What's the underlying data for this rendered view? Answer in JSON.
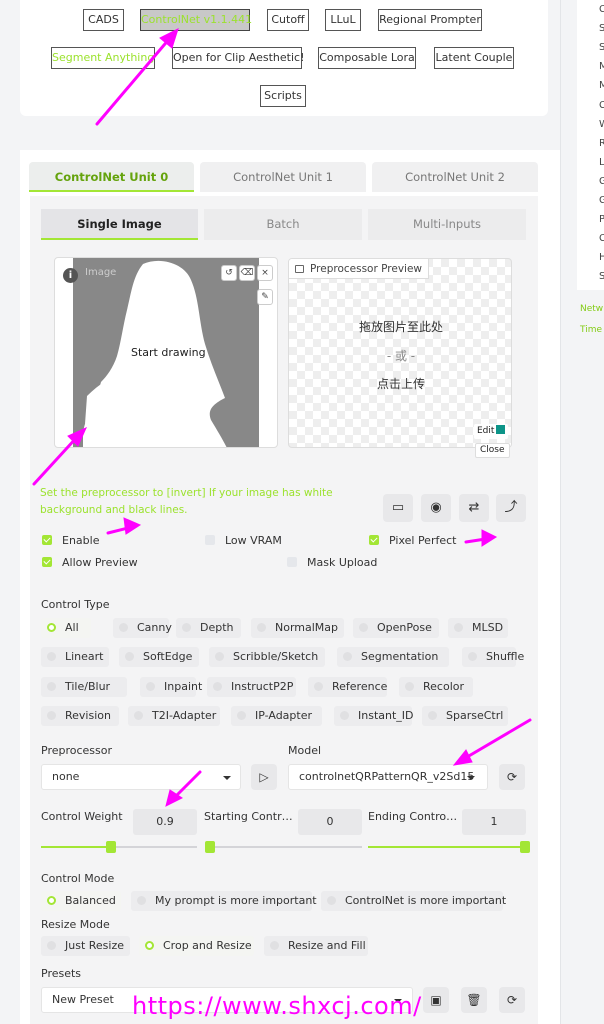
{
  "extensions": {
    "row1": [
      "CADS",
      "ControlNet v1.1.441",
      "Cutoff",
      "LLuL",
      "Regional Prompter"
    ],
    "row2": [
      "Segment Anything",
      "Open for Clip Aesthetic!",
      "Composable Lora",
      "Latent Couple"
    ],
    "row3": [
      "Scripts"
    ]
  },
  "right_sidebar": {
    "letters": [
      "C",
      "S",
      "S",
      "M",
      "M",
      "C",
      "W",
      "R",
      "L",
      "G",
      "G",
      "P",
      "C",
      "H",
      "S"
    ],
    "link1": "Netw",
    "link2": "Time"
  },
  "unit_tabs": [
    "ControlNet Unit 0",
    "ControlNet Unit 1",
    "ControlNet Unit 2"
  ],
  "image_tabs": [
    "Single Image",
    "Batch",
    "Multi-Inputs"
  ],
  "canvas": {
    "label": "Image",
    "start_drawing": "Start drawing",
    "info": "i"
  },
  "preview": {
    "title": "Preprocessor Preview",
    "drop_here": "拖放图片至此处",
    "or": "- 或 -",
    "click_upload": "点击上传",
    "edit": "Edit",
    "close": "Close"
  },
  "hint": "Set the preprocessor to [invert] If your image has white background and black lines.",
  "options": {
    "enable": "Enable",
    "low_vram": "Low VRAM",
    "pixel_perfect": "Pixel Perfect",
    "allow_preview": "Allow Preview",
    "mask_upload": "Mask Upload"
  },
  "control_type": {
    "label": "Control Type",
    "selected": "All",
    "row1": [
      "All",
      "Canny",
      "Depth",
      "NormalMap",
      "OpenPose",
      "MLSD"
    ],
    "row2": [
      "Lineart",
      "SoftEdge",
      "Scribble/Sketch",
      "Segmentation",
      "Shuffle"
    ],
    "row3": [
      "Tile/Blur",
      "Inpaint",
      "InstructP2P",
      "Reference",
      "Recolor"
    ],
    "row4": [
      "Revision",
      "T2I-Adapter",
      "IP-Adapter",
      "Instant_ID",
      "SparseCtrl"
    ]
  },
  "preprocessor": {
    "label": "Preprocessor",
    "value": "none"
  },
  "model": {
    "label": "Model",
    "value": "controlnetQRPatternQR_v2Sd15"
  },
  "control_weight": {
    "label": "Control Weight",
    "value": "0.9",
    "fraction": 0.45
  },
  "starting_control": {
    "label": "Starting Contr…",
    "value": "0",
    "fraction": 0.0
  },
  "ending_control": {
    "label": "Ending Contro…",
    "value": "1",
    "fraction": 1.0
  },
  "control_mode": {
    "label": "Control Mode",
    "options": [
      "Balanced",
      "My prompt is more important",
      "ControlNet is more important"
    ],
    "selected": "Balanced"
  },
  "resize_mode": {
    "label": "Resize Mode",
    "options": [
      "Just Resize",
      "Crop and Resize",
      "Resize and Fill"
    ],
    "selected": "Crop and Resize"
  },
  "presets": {
    "label": "Presets",
    "value": "New Preset"
  },
  "watermark": "https://www.shxcj.com/",
  "colors": {
    "accent": "#a3e635",
    "annotation": "#ff00ff",
    "hint": "#9be22d"
  }
}
